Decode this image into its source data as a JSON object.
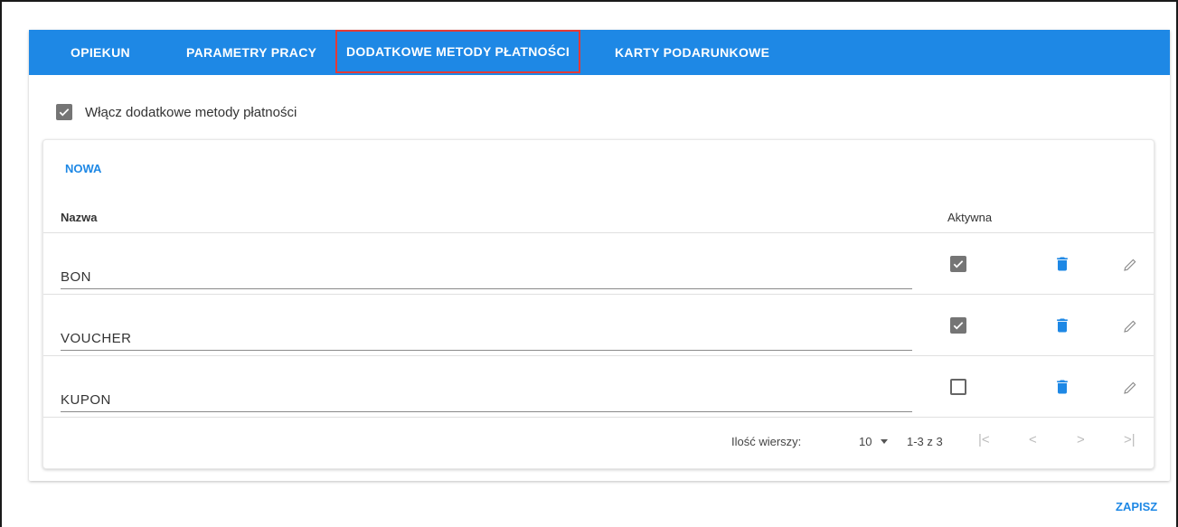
{
  "tabs": [
    {
      "label": "OPIEKUN"
    },
    {
      "label": "PARAMETRY PRACY"
    },
    {
      "label": "DODATKOWE METODY PŁATNOŚCI"
    },
    {
      "label": "KARTY PODARUNKOWE"
    }
  ],
  "enable_checkbox": {
    "label": "Włącz dodatkowe metody płatności",
    "checked": true
  },
  "new_button": "NOWA",
  "columns": {
    "name": "Nazwa",
    "active": "Aktywna"
  },
  "rows": [
    {
      "name": "BON",
      "active": true
    },
    {
      "name": "VOUCHER",
      "active": true
    },
    {
      "name": "KUPON",
      "active": false
    }
  ],
  "pagination": {
    "rows_label": "Ilość wierszy:",
    "rows_per_page": "10",
    "range": "1-3 z 3",
    "first": "|<",
    "prev": "<",
    "next": ">",
    "last": ">|"
  },
  "save_button": "ZAPISZ",
  "colors": {
    "accent": "#1e88e5",
    "highlight_border": "#e53935",
    "checkbox_checked": "#757575"
  },
  "icons": {
    "trash": "trash-icon",
    "edit": "pencil-icon",
    "check": "check-icon"
  }
}
